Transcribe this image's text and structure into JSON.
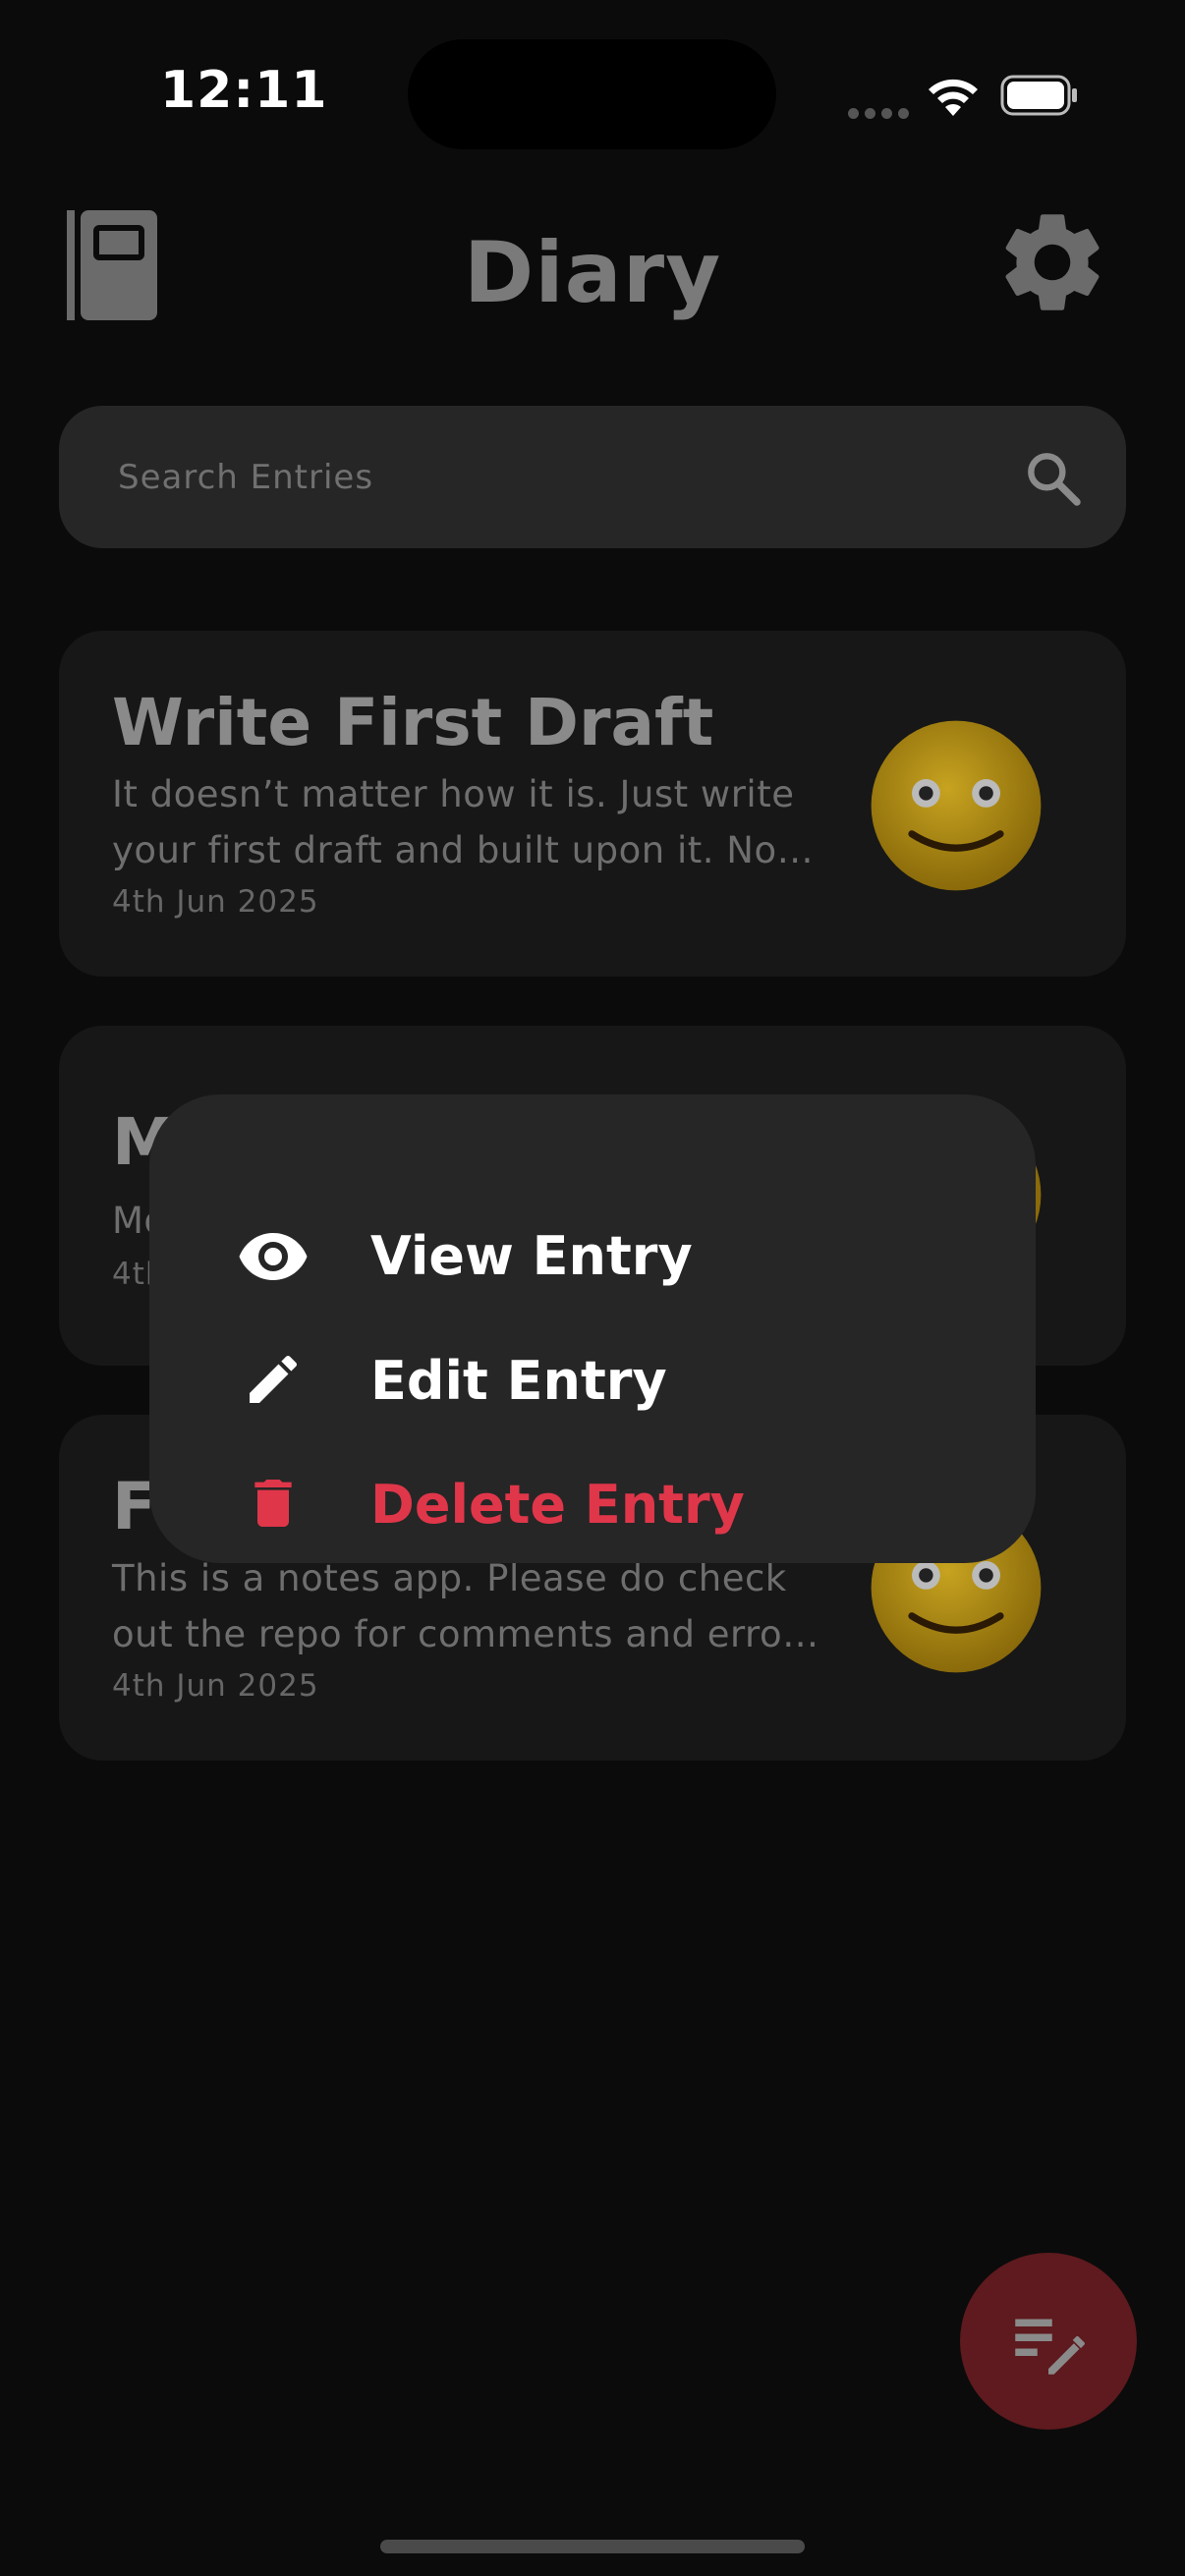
{
  "status_bar": {
    "time": "12:11"
  },
  "header": {
    "title": "Diary",
    "left_icon": "book-icon",
    "right_icon": "gear-icon"
  },
  "search": {
    "placeholder": "Search Entries",
    "icon": "search-icon"
  },
  "entries": [
    {
      "title": "Write First Draft",
      "excerpt_line1": "It doesn’t matter how it is. Just write",
      "excerpt_line2": "your first draft and built upon it. No…",
      "date": "4th Jun 2025",
      "mood": "smiley-emoji"
    },
    {
      "title": "M",
      "excerpt_line1": "Mo",
      "date": "4th",
      "mood": "smiley-emoji"
    },
    {
      "title": "Fi",
      "excerpt_line1": "This is a notes app. Please do check",
      "excerpt_line2": "out the repo for comments and erro…",
      "date": "4th Jun 2025",
      "mood": "smiley-emoji"
    }
  ],
  "context_menu": {
    "items": [
      {
        "label": "View Entry",
        "icon": "eye-icon"
      },
      {
        "label": "Edit Entry",
        "icon": "pencil-icon"
      },
      {
        "label": "Delete Entry",
        "icon": "trash-icon",
        "color": "#e0364a"
      }
    ]
  },
  "fab": {
    "icon": "new-note-icon",
    "color": "#5e1a1e"
  },
  "colors": {
    "background": "#0b0b0b",
    "card": "#171717",
    "menu": "#262626",
    "accent": "#e0364a"
  }
}
